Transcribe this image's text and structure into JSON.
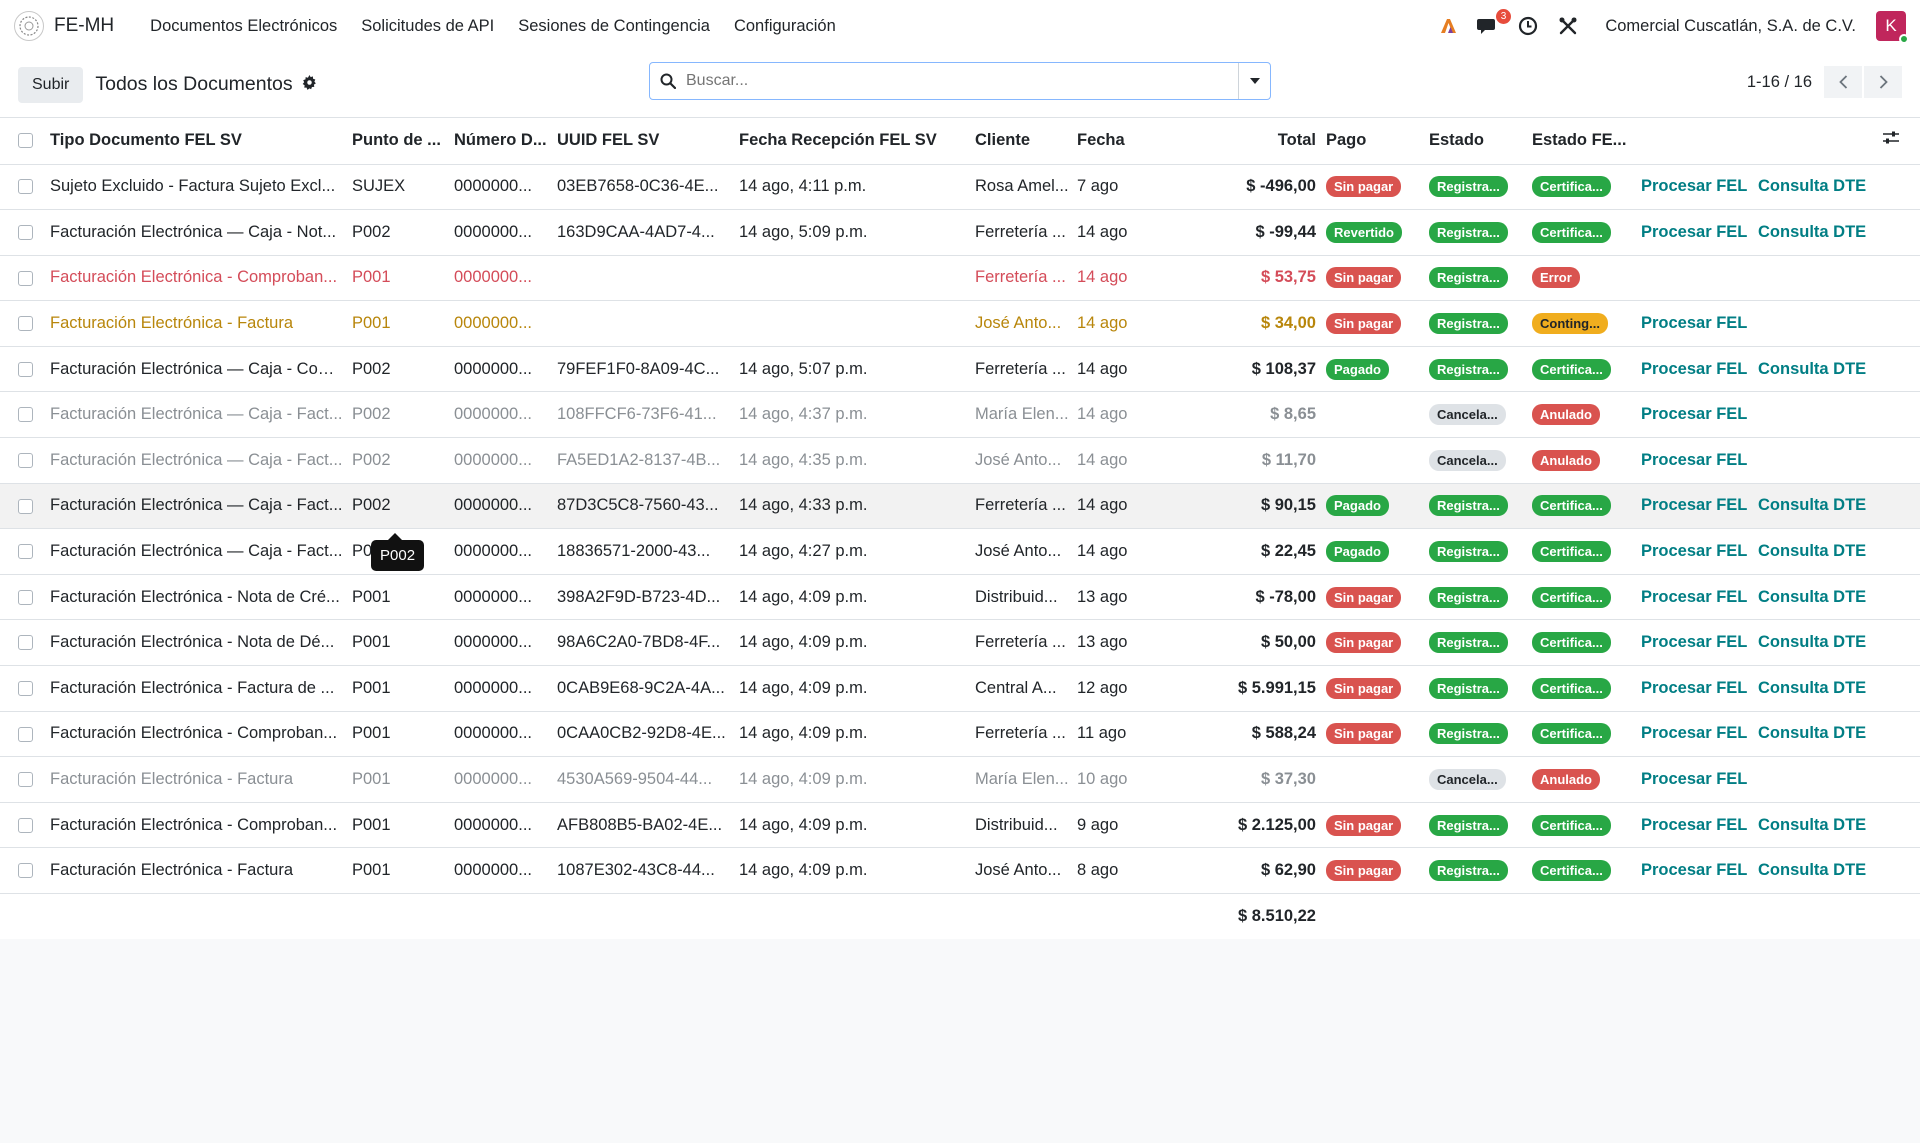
{
  "navbar": {
    "brand": "FE-MH",
    "menu": [
      "Documentos Electrónicos",
      "Solicitudes de API",
      "Sesiones de Contingencia",
      "Configuración"
    ],
    "notifications_count": "3",
    "company": "Comercial Cuscatlán, S.A. de C.V.",
    "avatar_letter": "K",
    "icons": [
      "ai-icon",
      "chat-icon",
      "clock-icon",
      "tools-icon"
    ]
  },
  "control": {
    "upload_label": "Subir",
    "title": "Todos los Documentos",
    "search_placeholder": "Buscar...",
    "pager": "1-16 / 16"
  },
  "table": {
    "headers": [
      "Tipo Documento FEL SV",
      "Punto de ...",
      "Número D...",
      "UUID FEL SV",
      "Fecha Recepción FEL SV",
      "Cliente",
      "Fecha",
      "Total",
      "Pago",
      "Estado",
      "Estado FE..."
    ],
    "rows": [
      {
        "tipo": "Sujeto Excluido - Factura Sujeto Excl...",
        "punto": "SUJEX",
        "numero": "0000000...",
        "uuid": "03EB7658-0C36-4E...",
        "fecha_rec": "14 ago, 4:11 p.m.",
        "cliente": "Rosa Amel...",
        "fecha": "7 ago",
        "total": "$ -496,00",
        "pago": "Sin pagar",
        "estado": "Registra...",
        "estado_fel": "Certifica...",
        "procesar": "Procesar FEL",
        "consulta": "Consulta DTE",
        "style": ""
      },
      {
        "tipo": "Facturación Electrónica — Caja - Not...",
        "punto": "P002",
        "numero": "0000000...",
        "uuid": "163D9CAA-4AD7-4...",
        "fecha_rec": "14 ago, 5:09 p.m.",
        "cliente": "Ferretería ...",
        "fecha": "14 ago",
        "total": "$ -99,44",
        "pago": "Revertido",
        "estado": "Registra...",
        "estado_fel": "Certifica...",
        "procesar": "Procesar FEL",
        "consulta": "Consulta DTE",
        "style": ""
      },
      {
        "tipo": "Facturación Electrónica - Comproban...",
        "punto": "P001",
        "numero": "0000000...",
        "uuid": "",
        "fecha_rec": "",
        "cliente": "Ferretería ...",
        "fecha": "14 ago",
        "total": "$ 53,75",
        "pago": "Sin pagar",
        "estado": "Registra...",
        "estado_fel": "Error",
        "procesar": "",
        "consulta": "",
        "style": "danger"
      },
      {
        "tipo": "Facturación Electrónica - Factura",
        "punto": "P001",
        "numero": "0000000...",
        "uuid": "",
        "fecha_rec": "",
        "cliente": "José Anto...",
        "fecha": "14 ago",
        "total": "$ 34,00",
        "pago": "Sin pagar",
        "estado": "Registra...",
        "estado_fel": "Conting...",
        "procesar": "Procesar FEL",
        "consulta": "",
        "style": "warning"
      },
      {
        "tipo": "Facturación Electrónica — Caja - Com...",
        "punto": "P002",
        "numero": "0000000...",
        "uuid": "79FEF1F0-8A09-4C...",
        "fecha_rec": "14 ago, 5:07 p.m.",
        "cliente": "Ferretería ...",
        "fecha": "14 ago",
        "total": "$ 108,37",
        "pago": "Pagado",
        "estado": "Registra...",
        "estado_fel": "Certifica...",
        "procesar": "Procesar FEL",
        "consulta": "Consulta DTE",
        "style": ""
      },
      {
        "tipo": "Facturación Electrónica — Caja - Fact...",
        "punto": "P002",
        "numero": "0000000...",
        "uuid": "108FFCF6-73F6-41...",
        "fecha_rec": "14 ago, 4:37 p.m.",
        "cliente": "María Elen...",
        "fecha": "14 ago",
        "total": "$ 8,65",
        "pago": "",
        "estado": "Cancela...",
        "estado_fel": "Anulado",
        "procesar": "Procesar FEL",
        "consulta": "",
        "style": "muted"
      },
      {
        "tipo": "Facturación Electrónica — Caja - Fact...",
        "punto": "P002",
        "numero": "0000000...",
        "uuid": "FA5ED1A2-8137-4B...",
        "fecha_rec": "14 ago, 4:35 p.m.",
        "cliente": "José Anto...",
        "fecha": "14 ago",
        "total": "$ 11,70",
        "pago": "",
        "estado": "Cancela...",
        "estado_fel": "Anulado",
        "procesar": "Procesar FEL",
        "consulta": "",
        "style": "muted"
      },
      {
        "tipo": "Facturación Electrónica — Caja - Fact...",
        "punto": "P002",
        "numero": "0000000...",
        "uuid": "87D3C5C8-7560-43...",
        "fecha_rec": "14 ago, 4:33 p.m.",
        "cliente": "Ferretería ...",
        "fecha": "14 ago",
        "total": "$ 90,15",
        "pago": "Pagado",
        "estado": "Registra...",
        "estado_fel": "Certifica...",
        "procesar": "Procesar FEL",
        "consulta": "Consulta DTE",
        "style": "hovered"
      },
      {
        "tipo": "Facturación Electrónica — Caja - Fact...",
        "punto": "P0",
        "numero": "0000000...",
        "uuid": "18836571-2000-43...",
        "fecha_rec": "14 ago, 4:27 p.m.",
        "cliente": "José Anto...",
        "fecha": "14 ago",
        "total": "$ 22,45",
        "pago": "Pagado",
        "estado": "Registra...",
        "estado_fel": "Certifica...",
        "procesar": "Procesar FEL",
        "consulta": "Consulta DTE",
        "style": ""
      },
      {
        "tipo": "Facturación Electrónica - Nota de Cré...",
        "punto": "P001",
        "numero": "0000000...",
        "uuid": "398A2F9D-B723-4D...",
        "fecha_rec": "14 ago, 4:09 p.m.",
        "cliente": "Distribuid...",
        "fecha": "13 ago",
        "total": "$ -78,00",
        "pago": "Sin pagar",
        "estado": "Registra...",
        "estado_fel": "Certifica...",
        "procesar": "Procesar FEL",
        "consulta": "Consulta DTE",
        "style": ""
      },
      {
        "tipo": "Facturación Electrónica - Nota de Dé...",
        "punto": "P001",
        "numero": "0000000...",
        "uuid": "98A6C2A0-7BD8-4F...",
        "fecha_rec": "14 ago, 4:09 p.m.",
        "cliente": "Ferretería ...",
        "fecha": "13 ago",
        "total": "$ 50,00",
        "pago": "Sin pagar",
        "estado": "Registra...",
        "estado_fel": "Certifica...",
        "procesar": "Procesar FEL",
        "consulta": "Consulta DTE",
        "style": ""
      },
      {
        "tipo": "Facturación Electrónica - Factura de ...",
        "punto": "P001",
        "numero": "0000000...",
        "uuid": "0CAB9E68-9C2A-4A...",
        "fecha_rec": "14 ago, 4:09 p.m.",
        "cliente": "Central A...",
        "fecha": "12 ago",
        "total": "$ 5.991,15",
        "pago": "Sin pagar",
        "estado": "Registra...",
        "estado_fel": "Certifica...",
        "procesar": "Procesar FEL",
        "consulta": "Consulta DTE",
        "style": ""
      },
      {
        "tipo": "Facturación Electrónica - Comproban...",
        "punto": "P001",
        "numero": "0000000...",
        "uuid": "0CAA0CB2-92D8-4E...",
        "fecha_rec": "14 ago, 4:09 p.m.",
        "cliente": "Ferretería ...",
        "fecha": "11 ago",
        "total": "$ 588,24",
        "pago": "Sin pagar",
        "estado": "Registra...",
        "estado_fel": "Certifica...",
        "procesar": "Procesar FEL",
        "consulta": "Consulta DTE",
        "style": ""
      },
      {
        "tipo": "Facturación Electrónica - Factura",
        "punto": "P001",
        "numero": "0000000...",
        "uuid": "4530A569-9504-44...",
        "fecha_rec": "14 ago, 4:09 p.m.",
        "cliente": "María Elen...",
        "fecha": "10 ago",
        "total": "$ 37,30",
        "pago": "",
        "estado": "Cancela...",
        "estado_fel": "Anulado",
        "procesar": "Procesar FEL",
        "consulta": "",
        "style": "muted"
      },
      {
        "tipo": "Facturación Electrónica - Comproban...",
        "punto": "P001",
        "numero": "0000000...",
        "uuid": "AFB808B5-BA02-4E...",
        "fecha_rec": "14 ago, 4:09 p.m.",
        "cliente": "Distribuid...",
        "fecha": "9 ago",
        "total": "$ 2.125,00",
        "pago": "Sin pagar",
        "estado": "Registra...",
        "estado_fel": "Certifica...",
        "procesar": "Procesar FEL",
        "consulta": "Consulta DTE",
        "style": ""
      },
      {
        "tipo": "Facturación Electrónica - Factura",
        "punto": "P001",
        "numero": "0000000...",
        "uuid": "1087E302-43C8-44...",
        "fecha_rec": "14 ago, 4:09 p.m.",
        "cliente": "José Anto...",
        "fecha": "8 ago",
        "total": "$ 62,90",
        "pago": "Sin pagar",
        "estado": "Registra...",
        "estado_fel": "Certifica...",
        "procesar": "Procesar FEL",
        "consulta": "Consulta DTE",
        "style": ""
      }
    ],
    "footer_total": "$ 8.510,22"
  },
  "tooltip": "P002",
  "colors": {
    "accent": "#017e84",
    "danger": "#d9534f",
    "success": "#28a745",
    "warning": "#f0ad1e",
    "avatar": "#c0265c"
  }
}
